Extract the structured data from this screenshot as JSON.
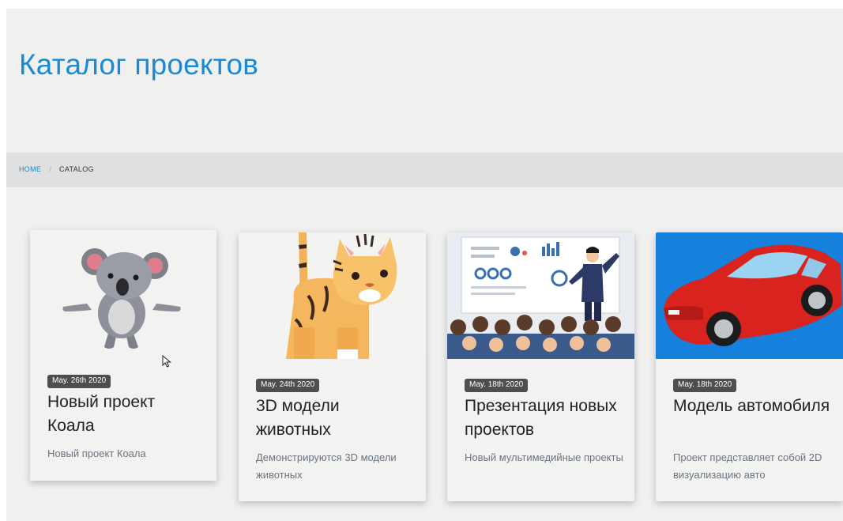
{
  "header": {
    "title": "Каталог проектов"
  },
  "breadcrumb": {
    "home": "HOME",
    "separator": "/",
    "current": "CATALOG"
  },
  "cards": [
    {
      "date": "May. 26th 2020",
      "title": "Новый проект Коала",
      "description": "Новый проект Коала",
      "image_icon": "koala-image"
    },
    {
      "date": "May. 24th 2020",
      "title": "3D модели животных",
      "description": "Демонстрируются 3D модели животных",
      "image_icon": "tiger-cub-image"
    },
    {
      "date": "May. 18th 2020",
      "title": "Презентация новых проектов",
      "description": "Новый мультимедийные проекты",
      "image_icon": "presentation-image"
    },
    {
      "date": "May. 18th 2020",
      "title": "Модель автомобиля",
      "description": "Проект представляет собой 2D визуализацию авто",
      "image_icon": "red-car-image"
    }
  ],
  "colors": {
    "accent": "#1a8ad3",
    "page_background": "#f0f0ef",
    "breadcrumb_background": "#dfe0df",
    "badge_background": "#4e4e4e"
  }
}
